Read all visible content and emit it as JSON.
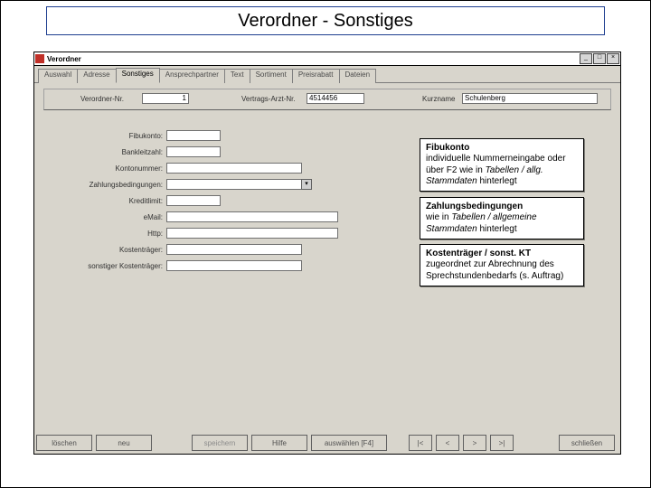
{
  "slide": {
    "title": "Verordner - Sonstiges"
  },
  "window": {
    "title": "Verordner"
  },
  "tabs": [
    {
      "label": "Auswahl"
    },
    {
      "label": "Adresse"
    },
    {
      "label": "Sonstiges"
    },
    {
      "label": "Ansprechpartner"
    },
    {
      "label": "Text"
    },
    {
      "label": "Sortiment"
    },
    {
      "label": "Preisrabatt"
    },
    {
      "label": "Dateien"
    }
  ],
  "header": {
    "nr_label": "Verordner-Nr.",
    "nr_value": "1",
    "arzt_label": "Vertrags-Arzt-Nr.",
    "arzt_value": "4514456",
    "kurz_label": "Kurzname",
    "kurz_value": "Schulenberg"
  },
  "form": {
    "fibukonto": "Fibukonto:",
    "bankleitzahl": "Bankleitzahl:",
    "kontonummer": "Kontonummer:",
    "zahlbed": "Zahlungsbedingungen:",
    "kreditlimit": "Kreditlimit:",
    "email": "eMail:",
    "http": "Http:",
    "kostentraeger": "Kostenträger:",
    "sonst_kt": "sonstiger Kostenträger:"
  },
  "notes": {
    "n1_title": "Fibukonto",
    "n1_l1": "individuelle Nummerneingabe ",
    "n1_l2a": "oder über F2 wie in ",
    "n1_l2b": "Tabellen / allg. Stammdaten",
    "n1_l3": " hinterlegt",
    "n2_title": "Zahlungsbedingungen",
    "n2_l1a": "wie in ",
    "n2_l1b": "Tabellen / allgemeine Stammdaten",
    "n2_l2": " hinterlegt",
    "n3_title": "Kostenträger / sonst. KT",
    "n3_l1": "zugeordnet zur Abrechnung ",
    "n3_l2": "des Sprechstundenbedarfs ",
    "n3_l3": "(s. Auftrag)"
  },
  "buttons": {
    "loeschen": "löschen",
    "neu": "neu",
    "speichern": "speichern",
    "hilfe": "Hilfe",
    "auswaehlen": "auswählen [F4]",
    "nav_first": "|<",
    "nav_prev": "<",
    "nav_next": ">",
    "nav_last": ">|",
    "schliessen": "schließen"
  }
}
